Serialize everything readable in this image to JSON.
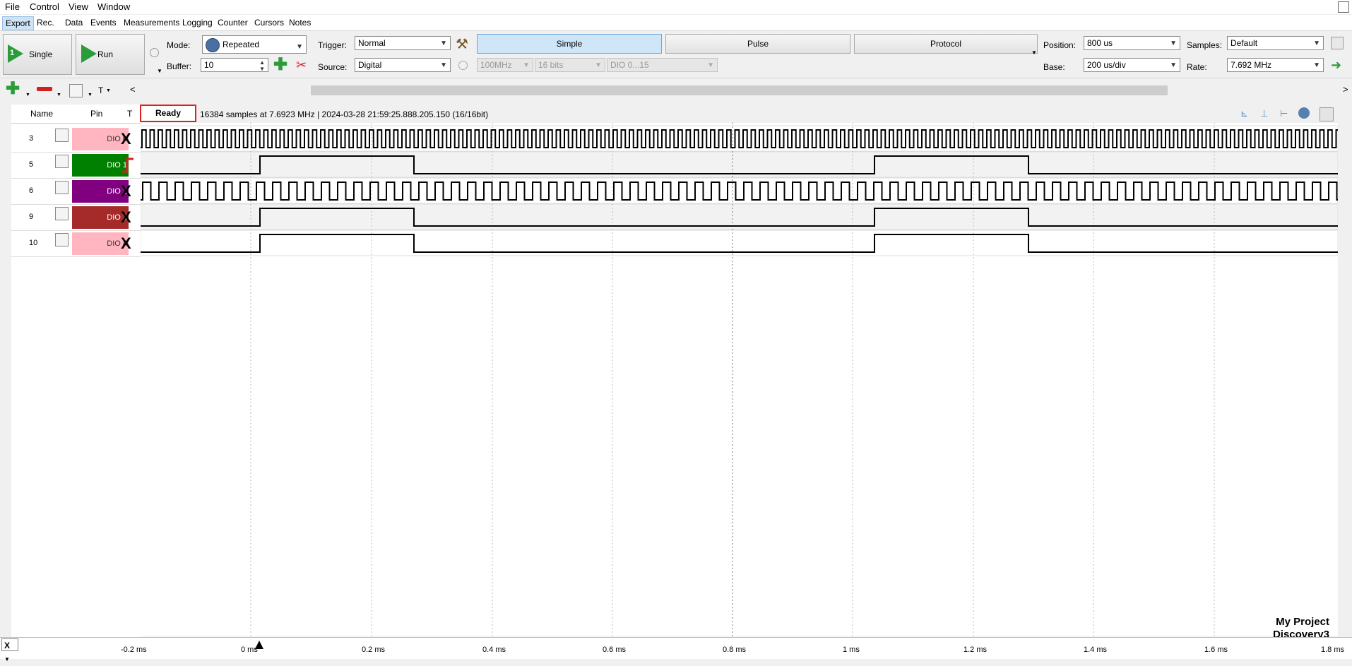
{
  "menu": [
    "File",
    "Control",
    "View",
    "Window"
  ],
  "tabs": [
    "Export",
    "Rec.",
    "Data",
    "Events",
    "Measurements",
    "Logging",
    "Counter",
    "Cursors",
    "Notes"
  ],
  "toolbar": {
    "single_label": "Single",
    "single_num": "1",
    "run_label": "Run",
    "mode_label": "Mode:",
    "mode_value": "Repeated",
    "buffer_label": "Buffer:",
    "buffer_value": "10",
    "trigger_label": "Trigger:",
    "trigger_value": "Normal",
    "source_label": "Source:",
    "source_value": "Digital",
    "freq_value": "100MHz",
    "bits_value": "16 bits",
    "dio_range": "DIO 0...15",
    "simple_label": "Simple",
    "pulse_label": "Pulse",
    "protocol_label": "Protocol",
    "position_label": "Position:",
    "position_value": "800 us",
    "base_label": "Base:",
    "base_value": "200 us/div",
    "samples_label": "Samples:",
    "samples_value": "Default",
    "rate_label": "Rate:",
    "rate_value": "7.692 MHz"
  },
  "toolbar2": {
    "t_label": "T",
    "back": "<",
    "fwd": ">"
  },
  "header": {
    "name": "Name",
    "pin": "Pin",
    "t": "T"
  },
  "status": {
    "ready": "Ready",
    "info": "16384 samples at 7.6923 MHz | 2024-03-28 21:59:25.888.205.150 (16/16bit)"
  },
  "channels": [
    {
      "num": "3",
      "pin": "DIO 0",
      "color": "#ffb6c1",
      "text_color": "#333333",
      "trigger": "X"
    },
    {
      "num": "5",
      "pin": "DIO 1",
      "color": "#008000",
      "text_color": "#ffffff",
      "trigger": "rise"
    },
    {
      "num": "6",
      "pin": "DIO 2",
      "color": "#800080",
      "text_color": "#ffffff",
      "trigger": "X"
    },
    {
      "num": "9",
      "pin": "DIO 3",
      "color": "#a52a2a",
      "text_color": "#ffffff",
      "trigger": "X"
    },
    {
      "num": "10",
      "pin": "DIO 4",
      "color": "#ffb6c1",
      "text_color": "#333333",
      "trigger": "X"
    }
  ],
  "axis": {
    "ticks": [
      "-0.2 ms",
      "0 ms",
      "0.2 ms",
      "0.4 ms",
      "0.6 ms",
      "0.8 ms",
      "1 ms",
      "1.2 ms",
      "1.4 ms",
      "1.6 ms",
      "1.8 ms"
    ],
    "x_button": "X"
  },
  "watermark": {
    "line1": "My Project",
    "line2": "Discovery3"
  },
  "colors": {
    "selected_tab": "#cfe3f6",
    "trigger_red": "#e02020",
    "play_green": "#2a9d3a"
  }
}
